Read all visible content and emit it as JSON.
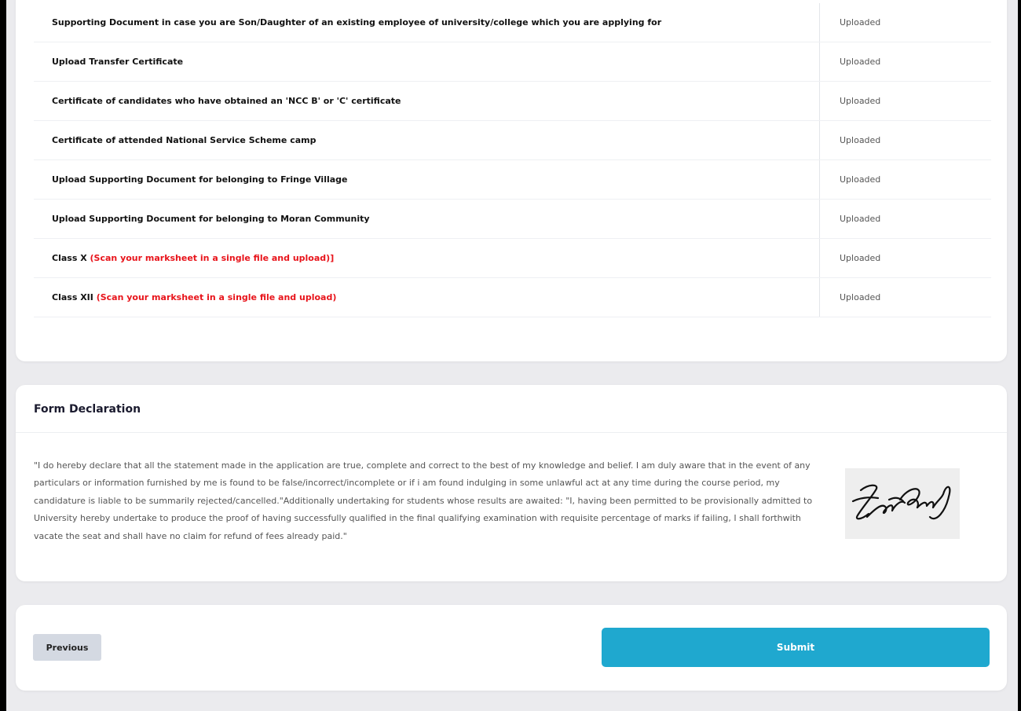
{
  "documents": [
    {
      "label": "Supporting Document in case you are Son/Daughter of an existing employee of university/college which you are applying for",
      "note": "",
      "status": "Uploaded"
    },
    {
      "label": "Upload Transfer Certificate",
      "note": "",
      "status": "Uploaded"
    },
    {
      "label": "Certificate of candidates who have obtained an 'NCC B' or 'C' certificate",
      "note": "",
      "status": "Uploaded"
    },
    {
      "label": "Certificate of attended National Service Scheme camp",
      "note": "",
      "status": "Uploaded"
    },
    {
      "label": "Upload Supporting Document for belonging to Fringe Village",
      "note": "",
      "status": "Uploaded"
    },
    {
      "label": "Upload Supporting Document for belonging to Moran Community",
      "note": "",
      "status": "Uploaded"
    },
    {
      "label": "Class X ",
      "note": "(Scan your marksheet in a single file and upload)]",
      "status": "Uploaded"
    },
    {
      "label": "Class XII ",
      "note": "(Scan your marksheet in a single file and upload)",
      "status": "Uploaded"
    }
  ],
  "declaration": {
    "title": "Form Declaration",
    "text": "\"I do hereby declare that all the statement made in the application are true, complete and correct to the best of my knowledge and belief. I am duly aware that in the event of any particulars or information furnished by me is found to be false/incorrect/incomplete or if i am found indulging in some unlawful act at any time during the course period, my candidature is liable to be summarily rejected/cancelled.\"Additionally undertaking for students whose results are awaited: \"I, having been permitted to be provisionally admitted to University hereby undertake to produce the proof of having successfully qualified in the final qualifying examination with requisite percentage of marks if failing, I shall forthwith vacate the seat and shall have no claim for refund of fees already paid.\""
  },
  "actions": {
    "previous_label": "Previous",
    "submit_label": "Submit"
  },
  "colors": {
    "accent": "#1fa8cf",
    "note_red": "#e8141b"
  }
}
